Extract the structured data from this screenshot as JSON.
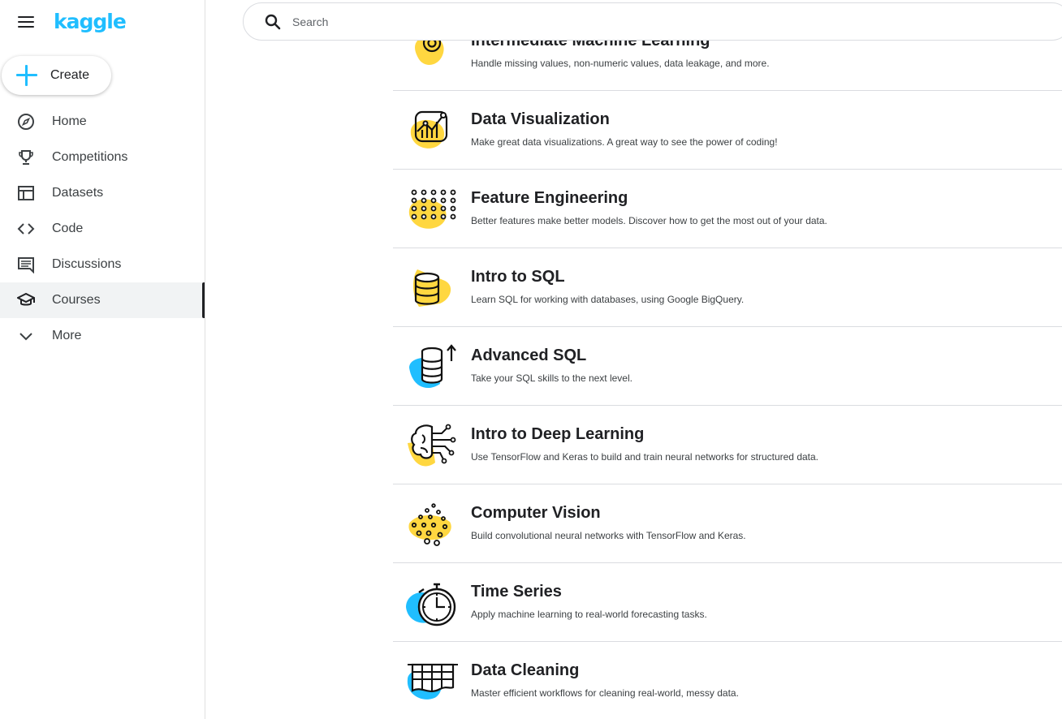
{
  "brand": {
    "logo_text": "kaggle",
    "accent_color": "#20beff"
  },
  "sidebar": {
    "create_label": "Create",
    "items": [
      {
        "label": "Home",
        "icon": "compass-icon"
      },
      {
        "label": "Competitions",
        "icon": "trophy-icon"
      },
      {
        "label": "Datasets",
        "icon": "table-icon"
      },
      {
        "label": "Code",
        "icon": "code-icon"
      },
      {
        "label": "Discussions",
        "icon": "comments-icon"
      },
      {
        "label": "Courses",
        "icon": "school-icon",
        "active": true
      },
      {
        "label": "More",
        "icon": "chevron-down-icon"
      }
    ]
  },
  "search": {
    "placeholder": "Search",
    "value": ""
  },
  "courses": [
    {
      "title": "Intermediate Machine Learning",
      "description": "Handle missing values, non-numeric values, data leakage, and more.",
      "icon": "target-icon",
      "blob_color": "#ffd740"
    },
    {
      "title": "Data Visualization",
      "description": "Make great data visualizations. A great way to see the power of coding!",
      "icon": "chart-icon",
      "blob_color": "#ffd740"
    },
    {
      "title": "Feature Engineering",
      "description": "Better features make better models. Discover how to get the most out of your data.",
      "icon": "dots-grid-icon",
      "blob_color": "#ffd740"
    },
    {
      "title": "Intro to SQL",
      "description": "Learn SQL for working with databases, using Google BigQuery.",
      "icon": "database-icon",
      "blob_color": "#ffd740"
    },
    {
      "title": "Advanced SQL",
      "description": "Take your SQL skills to the next level.",
      "icon": "database-up-icon",
      "blob_color": "#20beff"
    },
    {
      "title": "Intro to Deep Learning",
      "description": "Use TensorFlow and Keras to build and train neural networks for structured data.",
      "icon": "brain-icon",
      "blob_color": "#ffd740"
    },
    {
      "title": "Computer Vision",
      "description": "Build convolutional neural networks with TensorFlow and Keras.",
      "icon": "pixels-icon",
      "blob_color": "#ffd740"
    },
    {
      "title": "Time Series",
      "description": "Apply machine learning to real-world forecasting tasks.",
      "icon": "stopwatch-icon",
      "blob_color": "#20beff"
    },
    {
      "title": "Data Cleaning",
      "description": "Master efficient workflows for cleaning real-world, messy data.",
      "icon": "grid-sheet-icon",
      "blob_color": "#20beff"
    }
  ]
}
